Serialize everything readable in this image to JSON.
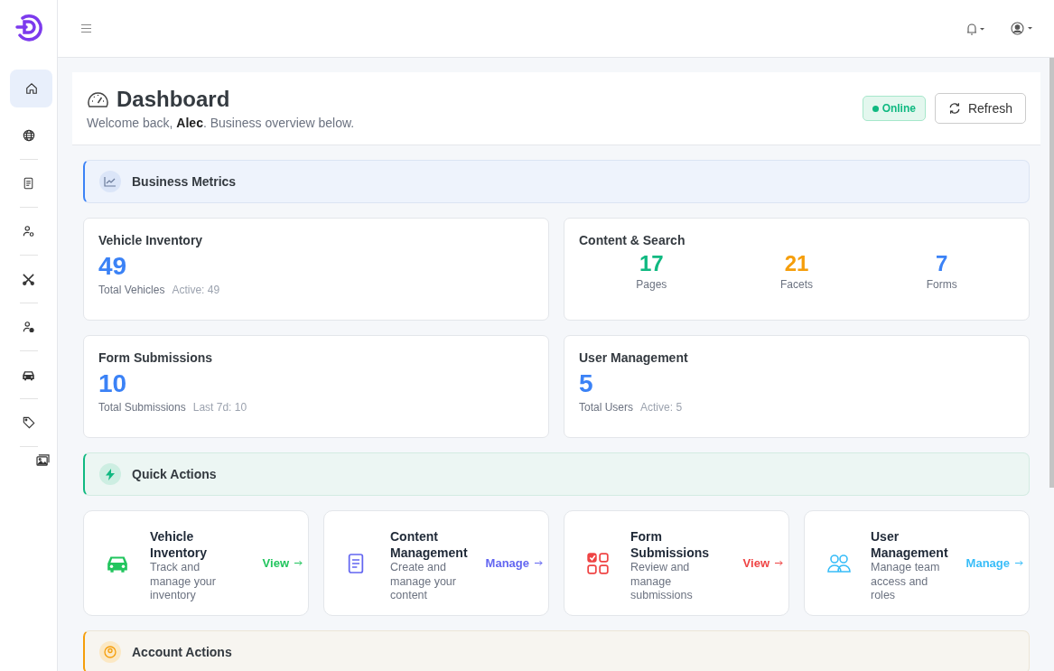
{
  "sidebar": {
    "items": [
      {
        "kind": "home",
        "selected": true
      },
      {
        "kind": "globe",
        "selected": false
      },
      {
        "kind": "document",
        "selected": false
      },
      {
        "kind": "user-gear",
        "selected": false
      },
      {
        "kind": "tools",
        "selected": false
      },
      {
        "kind": "user-check",
        "selected": false
      },
      {
        "kind": "car",
        "selected": false
      },
      {
        "kind": "tag",
        "selected": false
      },
      {
        "kind": "image",
        "selected": false
      }
    ]
  },
  "header": {
    "title": "Dashboard",
    "subtitle": "Welcome back, **Alec**. Business overview below.",
    "status": {
      "label": "Online",
      "online": true
    },
    "refresh_button": "Refresh"
  },
  "metrics_section": {
    "title": "Business Metrics"
  },
  "metric_cards": [
    {
      "kind": "single",
      "title": "Vehicle Inventory",
      "value": "49",
      "caption": "Total Vehicles",
      "detail": "Active: 49"
    },
    {
      "kind": "multi",
      "title": "Content & Search",
      "stats": [
        {
          "value": "17",
          "label": "Pages",
          "color": "#10b981"
        },
        {
          "value": "21",
          "label": "Facets",
          "color": "#f59e0b"
        },
        {
          "value": "7",
          "label": "Forms",
          "color": "#3b82f6"
        }
      ]
    },
    {
      "kind": "single",
      "title": "Form Submissions",
      "value": "10",
      "caption": "Total Submissions",
      "detail": "Last 7d: 10"
    },
    {
      "kind": "single",
      "title": "User Management",
      "value": "5",
      "caption": "Total Users",
      "detail": "Active: 5"
    }
  ],
  "quick_actions_section": {
    "title": "Quick Actions"
  },
  "quick_actions": [
    {
      "kind": "car",
      "title": "Vehicle Inventory",
      "description": "Track and manage your inventory",
      "link": "View",
      "color": "#22c55e"
    },
    {
      "kind": "document",
      "title": "Content Management",
      "description": "Create and manage your content",
      "link": "Manage",
      "color": "#6366f1"
    },
    {
      "kind": "forms",
      "title": "Form Submissions",
      "description": "Review and manage submissions",
      "link": "View",
      "color": "#ef4444"
    },
    {
      "kind": "users",
      "title": "User Management",
      "description": "Manage team access and roles",
      "link": "Manage",
      "color": "#38bdf8"
    }
  ],
  "account_section": {
    "title": "Account Actions"
  }
}
